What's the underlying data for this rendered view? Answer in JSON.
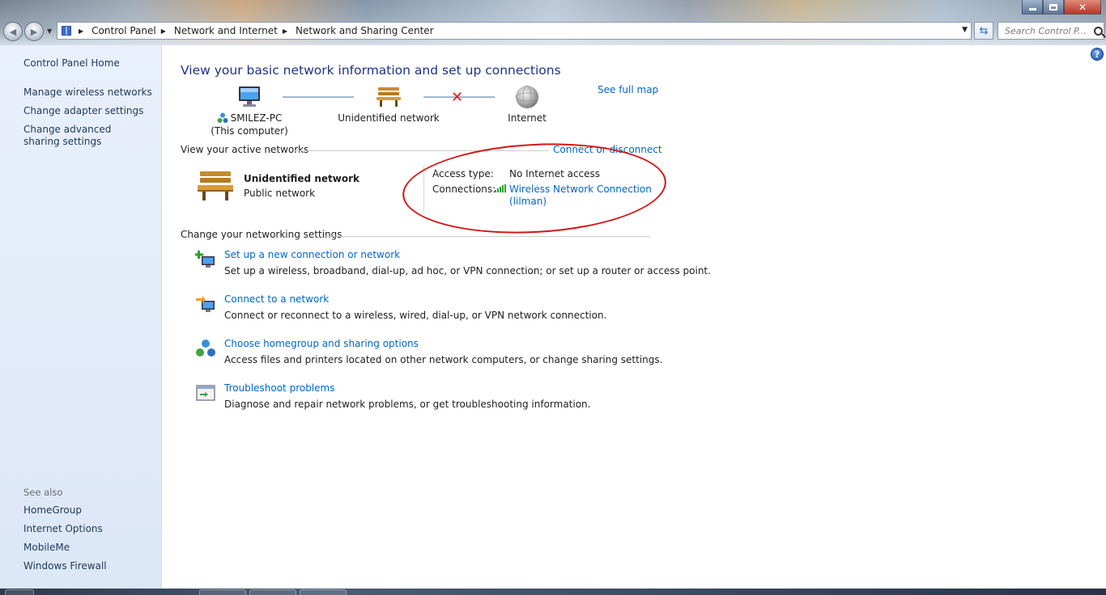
{
  "window": {
    "controls": {
      "minimize": "minimize",
      "maximize": "restore",
      "close": "✕"
    }
  },
  "nav": {
    "back_glyph": "◀",
    "forward_glyph": "▶",
    "breadcrumbs": [
      "Control Panel",
      "Network and Internet",
      "Network and Sharing Center"
    ],
    "refresh_glyph": "⇆",
    "search_placeholder": "Search Control P..."
  },
  "sidebar": {
    "home": "Control Panel Home",
    "items": [
      {
        "label": "Manage wireless networks"
      },
      {
        "label": "Change adapter settings"
      },
      {
        "label": "Change advanced sharing settings"
      }
    ],
    "see_also_heading": "See also",
    "see_also": [
      {
        "label": "HomeGroup"
      },
      {
        "label": "Internet Options"
      },
      {
        "label": "MobileMe"
      },
      {
        "label": "Windows Firewall"
      }
    ]
  },
  "main": {
    "title": "View your basic network information and set up connections",
    "see_full_map": "See full map",
    "help_glyph": "?",
    "map": {
      "computer_name": "SMILEZ-PC",
      "computer_sub": "(This computer)",
      "network_name": "Unidentified network",
      "internet": "Internet",
      "link_status": "disconnected"
    },
    "active_networks": {
      "heading": "View your active networks",
      "connect_link": "Connect or disconnect",
      "network_name": "Unidentified network",
      "network_category": "Public network",
      "access_type_label": "Access type:",
      "access_type_value": "No Internet access",
      "connections_label": "Connections:",
      "connection_line1": "Wireless Network Connection",
      "connection_line2": "(lilman)"
    },
    "settings": {
      "heading": "Change your networking settings",
      "tasks": [
        {
          "title": "Set up a new connection or network",
          "desc": "Set up a wireless, broadband, dial-up, ad hoc, or VPN connection; or set up a router or access point."
        },
        {
          "title": "Connect to a network",
          "desc": "Connect or reconnect to a wireless, wired, dial-up, or VPN network connection."
        },
        {
          "title": "Choose homegroup and sharing options",
          "desc": "Access files and printers located on other network computers, or change sharing settings."
        },
        {
          "title": "Troubleshoot problems",
          "desc": "Diagnose and repair network problems, or get troubleshooting information."
        }
      ]
    }
  },
  "colors": {
    "link": "#0066cc",
    "title": "#1e3287",
    "sidebar_link": "#1e395b",
    "annotation_oval": "#d41515",
    "disconnect_x": "#e21a1a"
  }
}
